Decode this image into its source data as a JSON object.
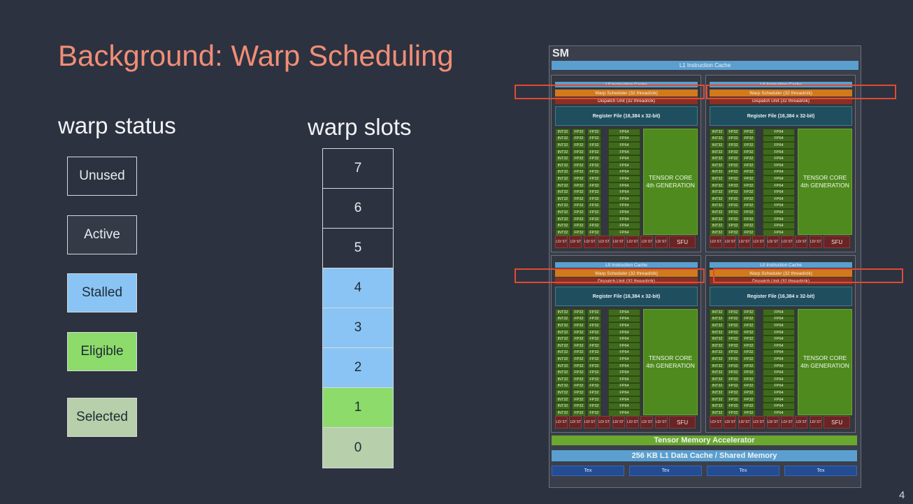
{
  "title": "Background: Warp Scheduling",
  "warp_status": {
    "heading": "warp status",
    "items": [
      {
        "label": "Unused",
        "fill": "#2d3240",
        "text_color": "#e9ecf0"
      },
      {
        "label": "Active",
        "fill": "#353a47",
        "text_color": "#e9ecf0"
      },
      {
        "label": "Stalled",
        "fill": "#89c4f4",
        "text_color": "#1f2a35"
      },
      {
        "label": "Eligible",
        "fill": "#8cdb6b",
        "text_color": "#1f2a35"
      },
      {
        "label": "Selected",
        "fill": "#b7cfaa",
        "text_color": "#1f2a35"
      }
    ]
  },
  "warp_slots": {
    "heading": "warp slots",
    "slots": [
      {
        "label": "7",
        "state": "Unused"
      },
      {
        "label": "6",
        "state": "Unused"
      },
      {
        "label": "5",
        "state": "Unused"
      },
      {
        "label": "4",
        "state": "Stalled"
      },
      {
        "label": "3",
        "state": "Stalled"
      },
      {
        "label": "2",
        "state": "Stalled"
      },
      {
        "label": "1",
        "state": "Eligible"
      },
      {
        "label": "0",
        "state": "Selected"
      }
    ]
  },
  "sm": {
    "label": "SM",
    "l1_instruction_cache": "L1 Instruction Cache",
    "partition": {
      "l0_cache": "L0 Instruction Cache",
      "warp_scheduler": "Warp Scheduler (32 thread/clk)",
      "dispatch_unit": "Dispatch Unit (32 thread/clk)",
      "register_file": "Register File (16,384 x 32-bit)",
      "int_label": "INT32",
      "fp32_label": "FP32",
      "fp64_label": "FP64",
      "tensor_line1": "TENSOR CORE",
      "tensor_line2": "4th GENERATION",
      "ldst_label": "LD/ ST",
      "sfu_label": "SFU"
    },
    "tensor_memory_accelerator": "Tensor Memory Accelerator",
    "l1_data_cache": "256 KB L1 Data Cache / Shared Memory",
    "tex_label": "Tex",
    "colors": {
      "cache_blue": "#5a9fcf",
      "scheduler_orange": "#d07a1c",
      "dispatch_red": "#8a2f24",
      "highlight_red": "#e24a31",
      "green": "#6aa82f"
    }
  },
  "page_number": "4"
}
